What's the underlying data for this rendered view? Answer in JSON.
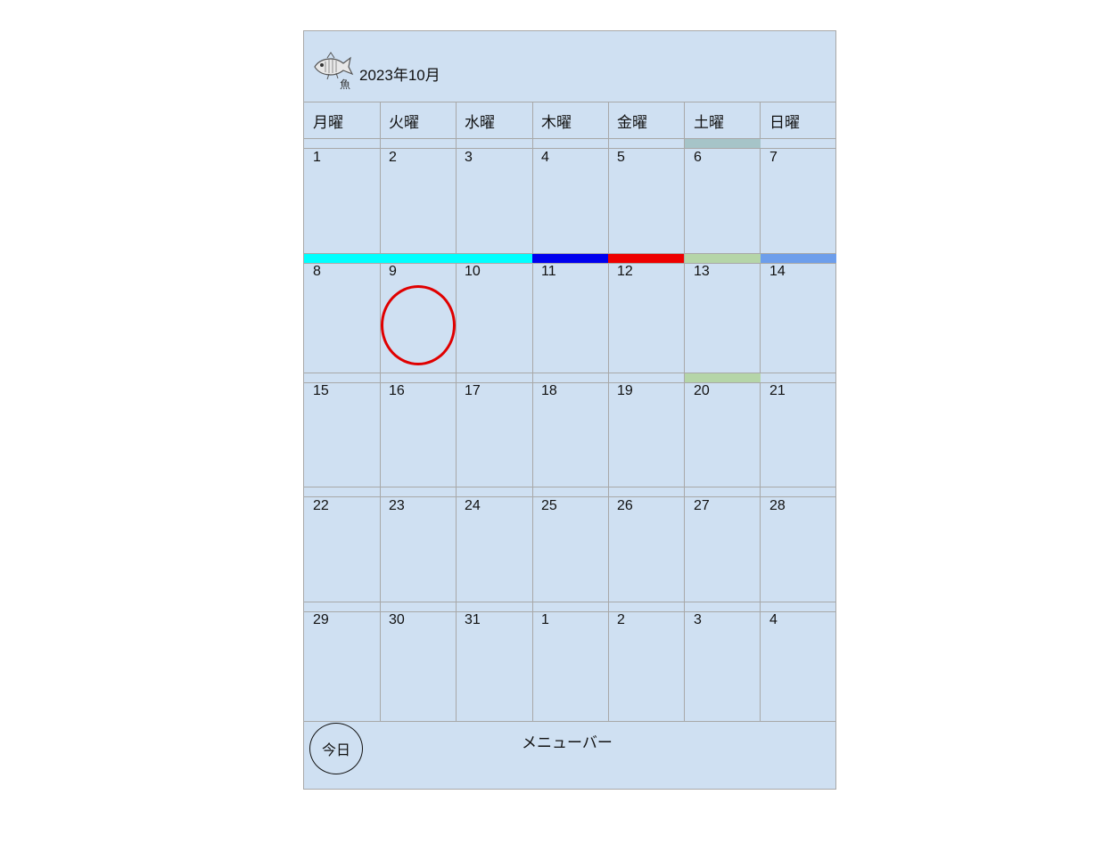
{
  "header": {
    "title": "2023年10月",
    "logo_text": "魚"
  },
  "weekdays": [
    "月曜",
    "火曜",
    "水曜",
    "木曜",
    "金曜",
    "土曜",
    "日曜"
  ],
  "weeks": [
    [
      "1",
      "2",
      "3",
      "4",
      "5",
      "6",
      "7"
    ],
    [
      "8",
      "9",
      "10",
      "11",
      "12",
      "13",
      "14"
    ],
    [
      "15",
      "16",
      "17",
      "18",
      "19",
      "20",
      "21"
    ],
    [
      "22",
      "23",
      "24",
      "25",
      "26",
      "27",
      "28"
    ],
    [
      "29",
      "30",
      "31",
      "1",
      "2",
      "3",
      "4"
    ]
  ],
  "colors": {
    "background": "#cfe0f2",
    "border": "#a8a8a8",
    "cyan": "#00ffff",
    "blue": "#0000ee",
    "red": "#ee0000",
    "sage": "#b5d5a8",
    "grayteal": "#a6c4c8",
    "cornflower": "#6d9eeb",
    "circle": "#e00000"
  },
  "footer": {
    "today_label": "今日",
    "menubar_label": "メニューバー"
  }
}
